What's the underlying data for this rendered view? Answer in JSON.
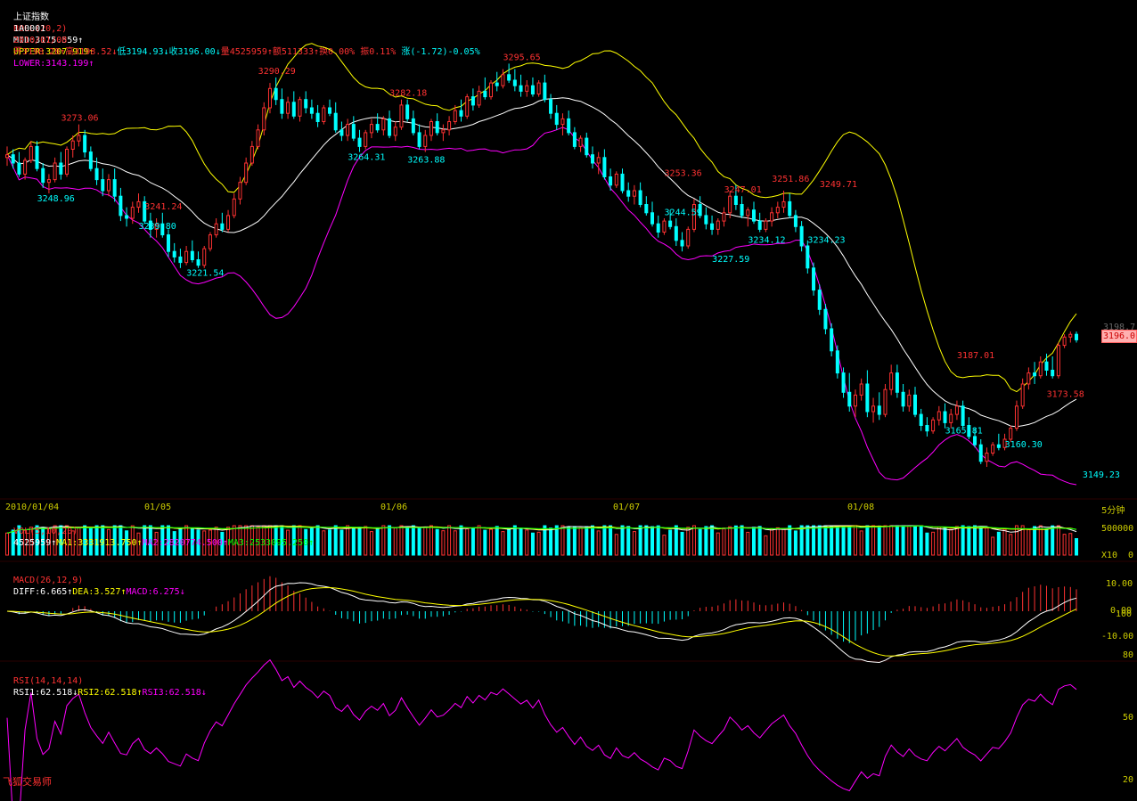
{
  "header": {
    "title": "上证指数",
    "boll_label": "BOLL(20,2)",
    "mid": "MID:3175.559↑",
    "upper": "UPPER:3207.919↑",
    "lower": "LOWER:3143.199↑",
    "code": "1A0001",
    "date": "2010/01/08",
    "open": "开3198.28↑",
    "high": "高3198.52↓",
    "low": "低3194.93↓",
    "close": "收3196.00↓",
    "volume": "量4525959↑",
    "amount": "额511333↑",
    "turnover": "换0.00%",
    "amplitude": "振0.11%",
    "change": "涨(-1.72)-0.05%"
  },
  "colors": {
    "up": "#ff3232",
    "down": "#00ffff",
    "boll_upper": "#ffff00",
    "boll_mid": "#ffffff",
    "boll_lower": "#ff00ff",
    "ma1": "#ffffff",
    "ma2": "#ffff00",
    "ma3": "#00ff00",
    "rsi": "#ff00ff",
    "axis_text": "#cccc00"
  },
  "date_axis": [
    "2010/01/04",
    "01/05",
    "01/06",
    "01/07",
    "01/08"
  ],
  "period_label": "5分钟",
  "vol_panel": {
    "label": "VOL(5,10,20)",
    "value": "4525959↑",
    "ma1": "MA1:3331913.750↑",
    "ma2": "MA2:2820774.500↑",
    "ma3": "MA3:2533095.250↑",
    "ticks": [
      "500000",
      "0"
    ],
    "unit": "X10"
  },
  "macd_panel": {
    "label": "MACD(26,12,9)",
    "diff": "DIFF:6.665↑",
    "dea": "DEA:3.527↑",
    "macd": "MACD:6.275↓",
    "ticks": [
      "10.00",
      "0.00",
      "-10.00"
    ]
  },
  "rsi_panel": {
    "label": "RSI(14,14,14)",
    "rsi1": "RSI1:62.518↓",
    "rsi2": "RSI2:62.518↑",
    "rsi3": "RSI3:62.518↓",
    "ticks": [
      "100",
      "80",
      "50",
      "20"
    ]
  },
  "price_axis": {
    "last_price": "3196.0",
    "partial_label": "3198.7"
  },
  "brand": "飞狐交易师",
  "chart_data": {
    "type": "candlestick",
    "title": "上证指数",
    "ylim": [
      3140,
      3310
    ],
    "annotations": [
      {
        "text": "3273.06",
        "i": 12,
        "v": 3274,
        "kind": "high"
      },
      {
        "text": "3248.96",
        "i": 8,
        "v": 3250,
        "kind": "low"
      },
      {
        "text": "3241.24",
        "i": 26,
        "v": 3242,
        "kind": "high"
      },
      {
        "text": "3239.80",
        "i": 25,
        "v": 3240,
        "kind": "low"
      },
      {
        "text": "3221.54",
        "i": 33,
        "v": 3223,
        "kind": "low"
      },
      {
        "text": "3290.29",
        "i": 45,
        "v": 3291,
        "kind": "high"
      },
      {
        "text": "3264.31",
        "i": 60,
        "v": 3265,
        "kind": "low"
      },
      {
        "text": "3282.18",
        "i": 67,
        "v": 3283,
        "kind": "high"
      },
      {
        "text": "3263.88",
        "i": 70,
        "v": 3264,
        "kind": "low"
      },
      {
        "text": "3295.65",
        "i": 86,
        "v": 3296,
        "kind": "high"
      },
      {
        "text": "3253.36",
        "i": 113,
        "v": 3254,
        "kind": "high"
      },
      {
        "text": "3244.59",
        "i": 113,
        "v": 3245,
        "kind": "low"
      },
      {
        "text": "3227.59",
        "i": 121,
        "v": 3228,
        "kind": "low"
      },
      {
        "text": "3247.01",
        "i": 123,
        "v": 3248,
        "kind": "high"
      },
      {
        "text": "3234.12",
        "i": 127,
        "v": 3235,
        "kind": "low"
      },
      {
        "text": "3251.86",
        "i": 131,
        "v": 3252,
        "kind": "high"
      },
      {
        "text": "3249.71",
        "i": 139,
        "v": 3250,
        "kind": "high"
      },
      {
        "text": "3234.23",
        "i": 137,
        "v": 3235,
        "kind": "low"
      },
      {
        "text": "3187.01",
        "i": 162,
        "v": 3188,
        "kind": "high"
      },
      {
        "text": "3165.81",
        "i": 160,
        "v": 3166,
        "kind": "low"
      },
      {
        "text": "3160.30",
        "i": 170,
        "v": 3161,
        "kind": "low"
      },
      {
        "text": "3173.58",
        "i": 177,
        "v": 3174,
        "kind": "high"
      },
      {
        "text": "3149.23",
        "i": 183,
        "v": 3150,
        "kind": "low"
      }
    ],
    "candles": [
      [
        3262,
        3266,
        3259,
        3263
      ],
      [
        3263,
        3265,
        3258,
        3260
      ],
      [
        3260,
        3264,
        3255,
        3256
      ],
      [
        3256,
        3262,
        3254,
        3261
      ],
      [
        3261,
        3268,
        3260,
        3266
      ],
      [
        3266,
        3268,
        3257,
        3258
      ],
      [
        3258,
        3260,
        3251,
        3253
      ],
      [
        3253,
        3256,
        3249,
        3254
      ],
      [
        3254,
        3262,
        3253,
        3260
      ],
      [
        3260,
        3264,
        3254,
        3256
      ],
      [
        3256,
        3266,
        3255,
        3265
      ],
      [
        3265,
        3270,
        3262,
        3268
      ],
      [
        3268,
        3274,
        3266,
        3270
      ],
      [
        3270,
        3272,
        3262,
        3264
      ],
      [
        3264,
        3266,
        3257,
        3258
      ],
      [
        3258,
        3262,
        3252,
        3254
      ],
      [
        3254,
        3258,
        3248,
        3250
      ],
      [
        3250,
        3256,
        3248,
        3254
      ],
      [
        3254,
        3258,
        3246,
        3248
      ],
      [
        3248,
        3251,
        3239,
        3241
      ],
      [
        3241,
        3244,
        3237,
        3240
      ],
      [
        3240,
        3246,
        3238,
        3244
      ],
      [
        3244,
        3249,
        3242,
        3246
      ],
      [
        3246,
        3248,
        3238,
        3239
      ],
      [
        3239,
        3242,
        3233,
        3236
      ],
      [
        3236,
        3240,
        3233,
        3238
      ],
      [
        3238,
        3242,
        3233,
        3234
      ],
      [
        3234,
        3236,
        3226,
        3228
      ],
      [
        3228,
        3231,
        3224,
        3226
      ],
      [
        3226,
        3229,
        3222,
        3224
      ],
      [
        3224,
        3230,
        3223,
        3228
      ],
      [
        3228,
        3232,
        3224,
        3225
      ],
      [
        3225,
        3228,
        3222,
        3223
      ],
      [
        3223,
        3230,
        3222,
        3229
      ],
      [
        3229,
        3235,
        3228,
        3234
      ],
      [
        3234,
        3240,
        3233,
        3238
      ],
      [
        3238,
        3242,
        3235,
        3236
      ],
      [
        3236,
        3243,
        3235,
        3241
      ],
      [
        3241,
        3249,
        3240,
        3247
      ],
      [
        3247,
        3255,
        3245,
        3253
      ],
      [
        3253,
        3262,
        3252,
        3260
      ],
      [
        3260,
        3268,
        3259,
        3266
      ],
      [
        3266,
        3274,
        3265,
        3272
      ],
      [
        3272,
        3282,
        3270,
        3280
      ],
      [
        3280,
        3289,
        3278,
        3287
      ],
      [
        3287,
        3291,
        3281,
        3283
      ],
      [
        3283,
        3287,
        3276,
        3278
      ],
      [
        3278,
        3284,
        3276,
        3282
      ],
      [
        3282,
        3286,
        3276,
        3277
      ],
      [
        3277,
        3284,
        3275,
        3283
      ],
      [
        3283,
        3286,
        3278,
        3280
      ],
      [
        3280,
        3283,
        3276,
        3278
      ],
      [
        3278,
        3281,
        3273,
        3275
      ],
      [
        3275,
        3281,
        3274,
        3280
      ],
      [
        3280,
        3283,
        3277,
        3278
      ],
      [
        3278,
        3282,
        3271,
        3272
      ],
      [
        3272,
        3275,
        3268,
        3270
      ],
      [
        3270,
        3276,
        3268,
        3274
      ],
      [
        3274,
        3277,
        3268,
        3269
      ],
      [
        3269,
        3272,
        3264,
        3266
      ],
      [
        3266,
        3272,
        3265,
        3271
      ],
      [
        3271,
        3276,
        3269,
        3274
      ],
      [
        3274,
        3278,
        3271,
        3272
      ],
      [
        3272,
        3277,
        3270,
        3276
      ],
      [
        3276,
        3279,
        3269,
        3270
      ],
      [
        3270,
        3275,
        3268,
        3273
      ],
      [
        3273,
        3283,
        3272,
        3281
      ],
      [
        3281,
        3283,
        3275,
        3276
      ],
      [
        3276,
        3279,
        3270,
        3271
      ],
      [
        3271,
        3274,
        3265,
        3266
      ],
      [
        3266,
        3272,
        3264,
        3270
      ],
      [
        3270,
        3276,
        3268,
        3275
      ],
      [
        3275,
        3278,
        3270,
        3271
      ],
      [
        3271,
        3274,
        3268,
        3272
      ],
      [
        3272,
        3277,
        3270,
        3275
      ],
      [
        3275,
        3281,
        3274,
        3279
      ],
      [
        3279,
        3283,
        3275,
        3277
      ],
      [
        3277,
        3285,
        3276,
        3284
      ],
      [
        3284,
        3287,
        3279,
        3281
      ],
      [
        3281,
        3288,
        3280,
        3286
      ],
      [
        3286,
        3291,
        3283,
        3284
      ],
      [
        3284,
        3290,
        3283,
        3289
      ],
      [
        3289,
        3293,
        3286,
        3288
      ],
      [
        3288,
        3294,
        3287,
        3292
      ],
      [
        3292,
        3296,
        3289,
        3290
      ],
      [
        3290,
        3294,
        3286,
        3288
      ],
      [
        3288,
        3292,
        3284,
        3286
      ],
      [
        3286,
        3290,
        3284,
        3288
      ],
      [
        3288,
        3291,
        3284,
        3285
      ],
      [
        3285,
        3290,
        3284,
        3289
      ],
      [
        3289,
        3292,
        3282,
        3283
      ],
      [
        3283,
        3285,
        3276,
        3278
      ],
      [
        3278,
        3281,
        3272,
        3274
      ],
      [
        3274,
        3278,
        3270,
        3276
      ],
      [
        3276,
        3279,
        3270,
        3271
      ],
      [
        3271,
        3273,
        3265,
        3266
      ],
      [
        3266,
        3270,
        3264,
        3269
      ],
      [
        3269,
        3271,
        3262,
        3263
      ],
      [
        3263,
        3266,
        3258,
        3260
      ],
      [
        3260,
        3264,
        3256,
        3262
      ],
      [
        3262,
        3265,
        3254,
        3255
      ],
      [
        3255,
        3258,
        3250,
        3252
      ],
      [
        3252,
        3257,
        3251,
        3256
      ],
      [
        3256,
        3258,
        3249,
        3250
      ],
      [
        3250,
        3253,
        3246,
        3248
      ],
      [
        3248,
        3252,
        3245,
        3250
      ],
      [
        3250,
        3253,
        3244,
        3245
      ],
      [
        3245,
        3248,
        3241,
        3242
      ],
      [
        3242,
        3246,
        3237,
        3238
      ],
      [
        3238,
        3241,
        3233,
        3235
      ],
      [
        3235,
        3240,
        3234,
        3239
      ],
      [
        3239,
        3243,
        3236,
        3237
      ],
      [
        3237,
        3240,
        3230,
        3232
      ],
      [
        3232,
        3235,
        3228,
        3230
      ],
      [
        3230,
        3237,
        3229,
        3236
      ],
      [
        3236,
        3247,
        3235,
        3245
      ],
      [
        3245,
        3248,
        3240,
        3241
      ],
      [
        3241,
        3244,
        3236,
        3238
      ],
      [
        3238,
        3241,
        3234,
        3236
      ],
      [
        3236,
        3240,
        3234,
        3239
      ],
      [
        3239,
        3244,
        3237,
        3242
      ],
      [
        3242,
        3250,
        3240,
        3248
      ],
      [
        3248,
        3252,
        3243,
        3245
      ],
      [
        3245,
        3248,
        3240,
        3241
      ],
      [
        3241,
        3244,
        3237,
        3243
      ],
      [
        3243,
        3246,
        3238,
        3239
      ],
      [
        3239,
        3242,
        3235,
        3236
      ],
      [
        3236,
        3240,
        3235,
        3239
      ],
      [
        3239,
        3244,
        3237,
        3242
      ],
      [
        3242,
        3246,
        3240,
        3244
      ],
      [
        3244,
        3250,
        3242,
        3246
      ],
      [
        3246,
        3249,
        3240,
        3241
      ],
      [
        3241,
        3243,
        3235,
        3237
      ],
      [
        3237,
        3239,
        3228,
        3230
      ],
      [
        3230,
        3232,
        3220,
        3222
      ],
      [
        3222,
        3224,
        3212,
        3214
      ],
      [
        3214,
        3216,
        3205,
        3207
      ],
      [
        3207,
        3209,
        3198,
        3200
      ],
      [
        3200,
        3202,
        3190,
        3192
      ],
      [
        3192,
        3194,
        3182,
        3184
      ],
      [
        3184,
        3186,
        3175,
        3177
      ],
      [
        3177,
        3184,
        3170,
        3172
      ],
      [
        3172,
        3178,
        3168,
        3176
      ],
      [
        3176,
        3182,
        3174,
        3180
      ],
      [
        3180,
        3185,
        3168,
        3170
      ],
      [
        3170,
        3175,
        3166,
        3172
      ],
      [
        3172,
        3177,
        3167,
        3169
      ],
      [
        3169,
        3180,
        3168,
        3178
      ],
      [
        3178,
        3187,
        3176,
        3184
      ],
      [
        3184,
        3187,
        3175,
        3177
      ],
      [
        3177,
        3180,
        3170,
        3172
      ],
      [
        3172,
        3178,
        3170,
        3176
      ],
      [
        3176,
        3179,
        3168,
        3169
      ],
      [
        3169,
        3171,
        3163,
        3165
      ],
      [
        3165,
        3168,
        3161,
        3163
      ],
      [
        3163,
        3168,
        3162,
        3167
      ],
      [
        3167,
        3172,
        3165,
        3170
      ],
      [
        3170,
        3173,
        3164,
        3166
      ],
      [
        3166,
        3171,
        3164,
        3169
      ],
      [
        3169,
        3174,
        3167,
        3172
      ],
      [
        3172,
        3174,
        3164,
        3165
      ],
      [
        3165,
        3168,
        3160,
        3161
      ],
      [
        3161,
        3164,
        3157,
        3158
      ],
      [
        3158,
        3160,
        3151,
        3152
      ],
      [
        3152,
        3157,
        3150,
        3155
      ],
      [
        3155,
        3159,
        3154,
        3158
      ],
      [
        3158,
        3162,
        3156,
        3157
      ],
      [
        3157,
        3162,
        3156,
        3160
      ],
      [
        3160,
        3165,
        3159,
        3164
      ],
      [
        3164,
        3174,
        3163,
        3172
      ],
      [
        3172,
        3182,
        3171,
        3180
      ],
      [
        3180,
        3186,
        3178,
        3184
      ],
      [
        3184,
        3188,
        3180,
        3183
      ],
      [
        3183,
        3190,
        3182,
        3188
      ],
      [
        3188,
        3191,
        3183,
        3185
      ],
      [
        3185,
        3190,
        3182,
        3183
      ],
      [
        3183,
        3195,
        3182,
        3194
      ],
      [
        3194,
        3198,
        3193,
        3197
      ],
      [
        3197,
        3199,
        3195,
        3198
      ],
      [
        3198,
        3199,
        3195,
        3196
      ]
    ]
  }
}
